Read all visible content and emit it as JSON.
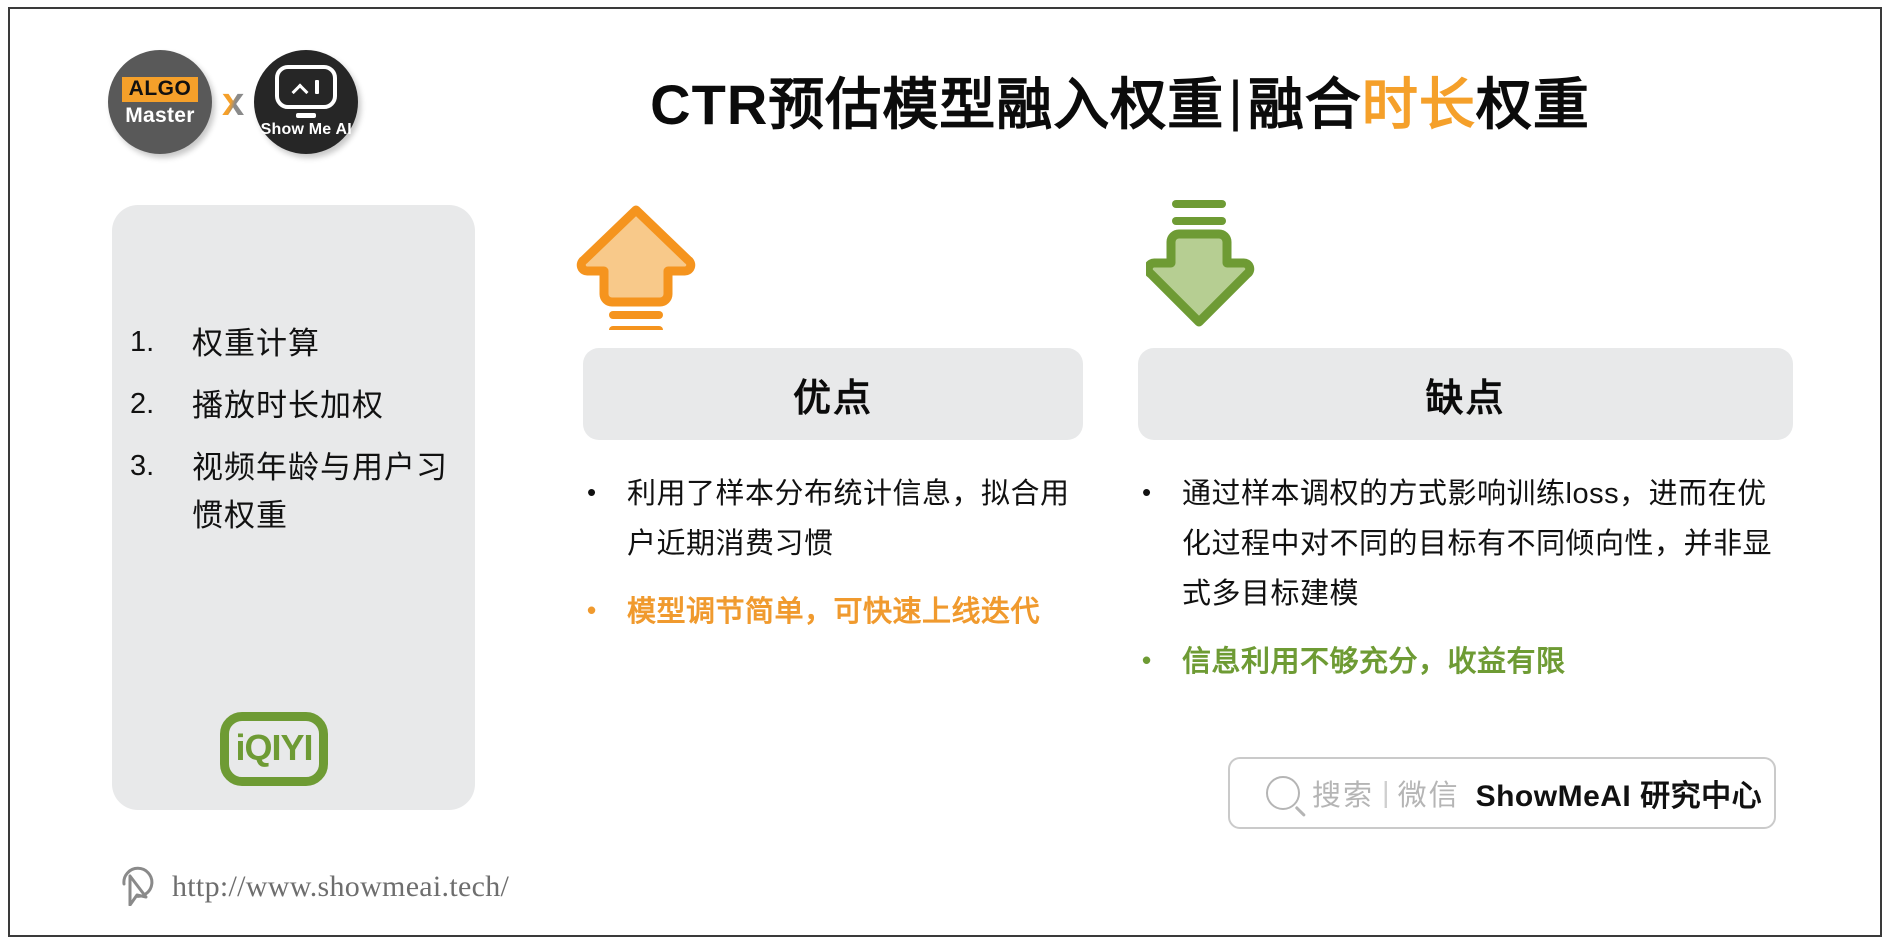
{
  "slide": {
    "title_prefix": "CTR预估模型融入权重",
    "title_separator": "|",
    "title_mid": "融合",
    "title_highlight": "时长",
    "title_suffix": "权重",
    "accent_orange": "#F5A02A",
    "accent_green": "#6E9B34",
    "panel_grey": "#E8E9EA"
  },
  "logos": {
    "algo_tag": "ALGO",
    "algo_sub": "Master",
    "cross": "x",
    "showmeai_text": "Show Me AI"
  },
  "sidebar": {
    "items": [
      {
        "num": "1.",
        "label": "权重计算"
      },
      {
        "num": "2.",
        "label": "播放时长加权"
      },
      {
        "num": "3.",
        "label": "视频年龄与用户习惯权重"
      }
    ],
    "brand_logo_text": "iQIYI"
  },
  "columns": [
    {
      "key": "pros",
      "header": "优点",
      "arrow": "arrow-up-icon",
      "bullets": [
        {
          "marker": "•",
          "text": "利用了样本分布统计信息，拟合用户近期消费习惯",
          "accent": "none"
        },
        {
          "marker": "•",
          "text": "模型调节简单，可快速上线迭代",
          "accent": "orange"
        }
      ]
    },
    {
      "key": "cons",
      "header": "缺点",
      "arrow": "arrow-down-icon",
      "bullets": [
        {
          "marker": "•",
          "text": "通过样本调权的方式影响训练loss，进而在优化过程中对不同的目标有不同倾向性，并非显式多目标建模",
          "accent": "none"
        },
        {
          "marker": "•",
          "text": "信息利用不够充分，收益有限",
          "accent": "green"
        }
      ]
    }
  ],
  "search_badge": {
    "placeholder": "搜索",
    "pipe": "|",
    "channel": "微信",
    "brand": "ShowMeAI 研究中心"
  },
  "footer": {
    "url": "http://www.showmeai.tech/"
  }
}
